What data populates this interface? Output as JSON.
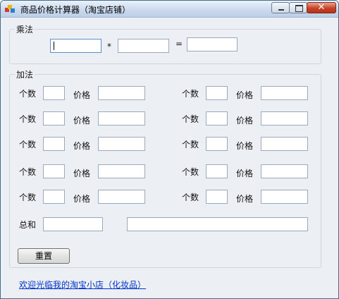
{
  "window": {
    "title": "商品价格计算器（淘宝店铺）"
  },
  "multiply": {
    "group_title": "乘法",
    "operand1": "",
    "times_sign": "*",
    "operand2": "",
    "equals_sign": "=",
    "result": ""
  },
  "add": {
    "group_title": "加法",
    "qty_label": "个数",
    "price_label": "价格",
    "left_rows": [
      {
        "qty": "",
        "price": ""
      },
      {
        "qty": "",
        "price": ""
      },
      {
        "qty": "",
        "price": ""
      },
      {
        "qty": "",
        "price": ""
      },
      {
        "qty": "",
        "price": ""
      }
    ],
    "right_rows": [
      {
        "qty": "",
        "price": ""
      },
      {
        "qty": "",
        "price": ""
      },
      {
        "qty": "",
        "price": ""
      },
      {
        "qty": "",
        "price": ""
      },
      {
        "qty": "",
        "price": ""
      }
    ],
    "total_label": "总和",
    "total_value": "",
    "total_text": ""
  },
  "reset_label": "重置",
  "shop_link": "欢迎光临我的淘宝小店（化妆品）"
}
